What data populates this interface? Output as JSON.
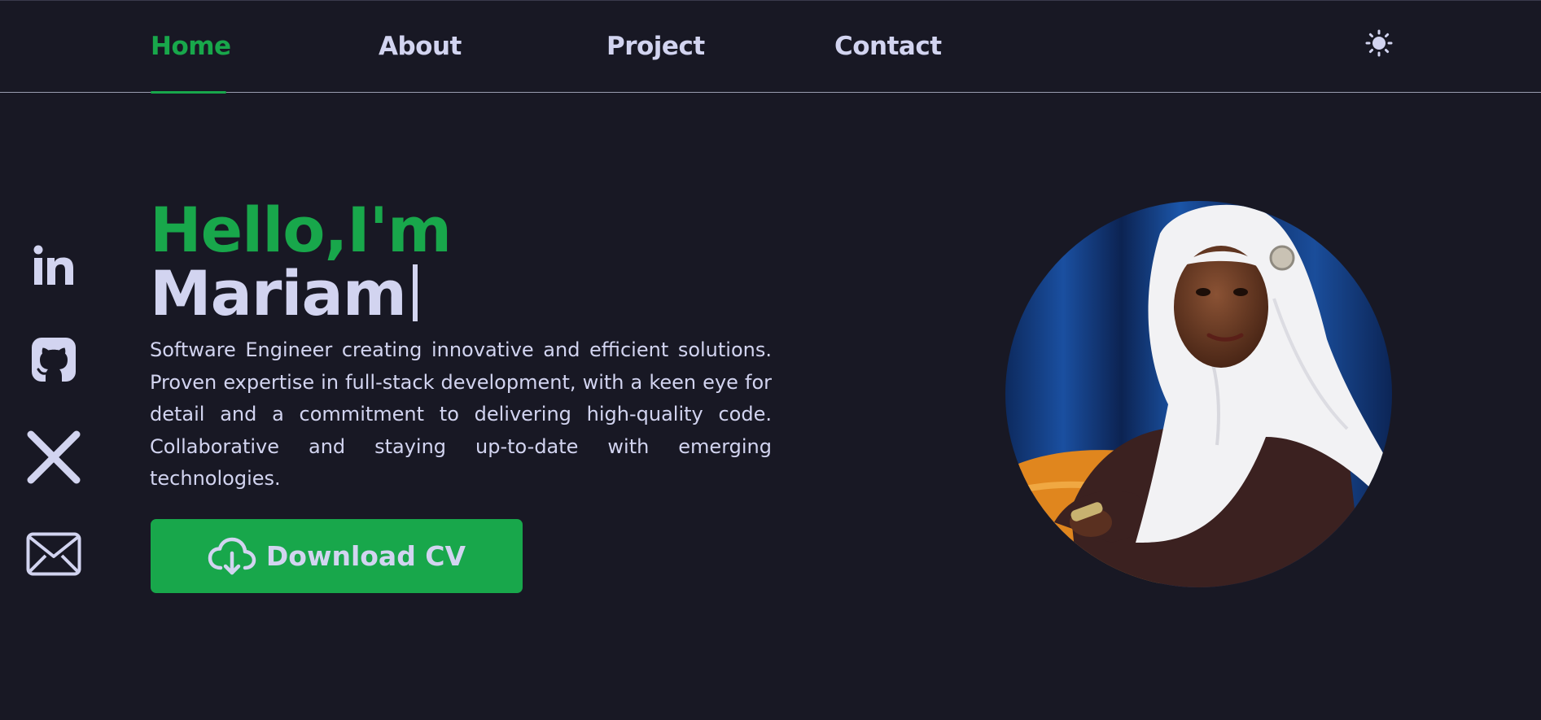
{
  "nav": {
    "links": [
      {
        "label": "Home",
        "active": true
      },
      {
        "label": "About",
        "active": false
      },
      {
        "label": "Project",
        "active": false
      },
      {
        "label": "Contact",
        "active": false
      }
    ],
    "theme_icon": "sun-icon"
  },
  "social": [
    {
      "icon": "linkedin-icon"
    },
    {
      "icon": "github-icon"
    },
    {
      "icon": "x-twitter-icon"
    },
    {
      "icon": "email-icon"
    }
  ],
  "hero": {
    "greeting": "Hello,I'm",
    "name": "Mariam",
    "description": "Software Engineer creating innovative and efficient solutions. Proven expertise in full-stack development, with a keen eye for detail and a commitment to delivering high-quality code. Collaborative and staying up-to-date with emerging technologies.",
    "cv_button": {
      "label": "Download CV",
      "icon": "cloud-download-icon"
    }
  },
  "profile": {
    "image": "profile-photo"
  },
  "colors": {
    "background": "#181824",
    "accent": "#18a74b",
    "text": "#d2d4f0"
  }
}
